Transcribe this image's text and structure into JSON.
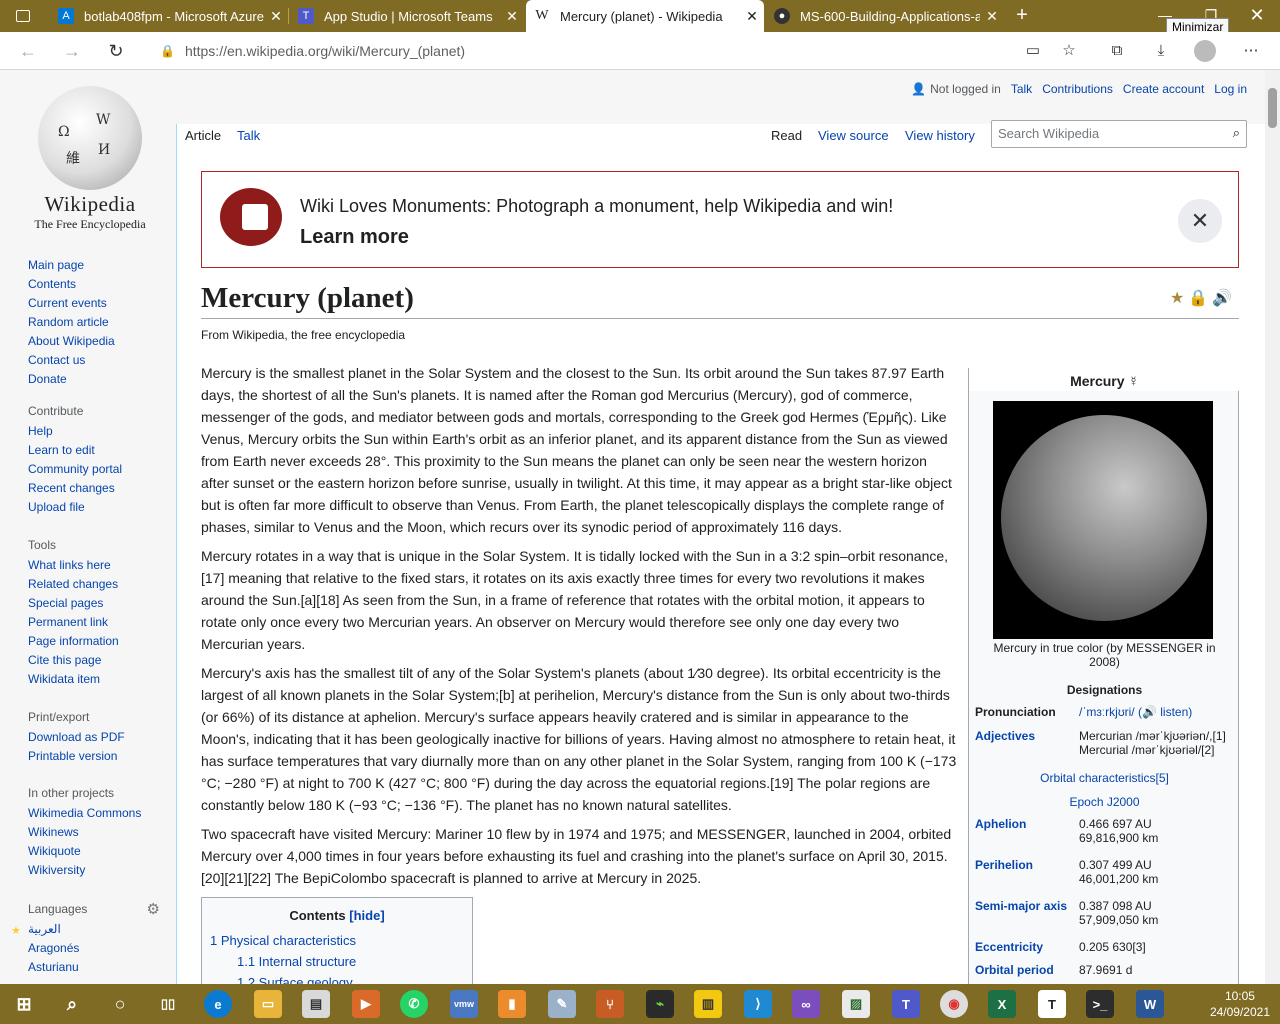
{
  "browser": {
    "tabs": [
      {
        "title": "botlab408fpm - Microsoft Azure",
        "icon": "azure-icon",
        "color": "#0078d4"
      },
      {
        "title": "App Studio | Microsoft Teams",
        "icon": "teams-icon",
        "color": "#5059c9"
      },
      {
        "title": "Mercury (planet) - Wikipedia",
        "icon": "wikipedia-icon",
        "active": true
      },
      {
        "title": "MS-600-Building-Applications-a",
        "icon": "github-icon"
      }
    ],
    "tooltip": "Minimizar",
    "url": "https://en.wikipedia.org/wiki/Mercury_(planet)"
  },
  "wiki": {
    "logo_wordmark": "Wikipedia",
    "logo_tagline": "The Free Encyclopedia",
    "nav": [
      "Main page",
      "Contents",
      "Current events",
      "Random article",
      "About Wikipedia",
      "Contact us",
      "Donate"
    ],
    "contribute": {
      "title": "Contribute",
      "items": [
        "Help",
        "Learn to edit",
        "Community portal",
        "Recent changes",
        "Upload file"
      ]
    },
    "tools": {
      "title": "Tools",
      "items": [
        "What links here",
        "Related changes",
        "Special pages",
        "Permanent link",
        "Page information",
        "Cite this page",
        "Wikidata item"
      ]
    },
    "print": {
      "title": "Print/export",
      "items": [
        "Download as PDF",
        "Printable version"
      ]
    },
    "projects": {
      "title": "In other projects",
      "items": [
        "Wikimedia Commons",
        "Wikinews",
        "Wikiquote",
        "Wikiversity"
      ]
    },
    "languages": {
      "title": "Languages",
      "items": [
        "العربية",
        "Aragonés",
        "Asturianu"
      ]
    },
    "user": {
      "not_logged": "Not logged in",
      "talk": "Talk",
      "contributions": "Contributions",
      "create": "Create account",
      "login": "Log in"
    },
    "tabs": {
      "article": "Article",
      "talk": "Talk",
      "read": "Read",
      "source": "View source",
      "history": "View history"
    },
    "search_placeholder": "Search Wikipedia",
    "banner": {
      "text": "Wiki Loves Monuments: Photograph a monument, help Wikipedia and win!",
      "more": "Learn more"
    },
    "title": "Mercury (planet)",
    "from": "From Wikipedia, the free encyclopedia",
    "paragraphs": [
      "Mercury is the smallest planet in the Solar System and the closest to the Sun. Its orbit around the Sun takes 87.97 Earth days, the shortest of all the Sun's planets. It is named after the Roman god Mercurius (Mercury), god of commerce, messenger of the gods, and mediator between gods and mortals, corresponding to the Greek god Hermes (Ἑρμῆς). Like Venus, Mercury orbits the Sun within Earth's orbit as an inferior planet, and its apparent distance from the Sun as viewed from Earth never exceeds 28°. This proximity to the Sun means the planet can only be seen near the western horizon after sunset or the eastern horizon before sunrise, usually in twilight. At this time, it may appear as a bright star-like object but is often far more difficult to observe than Venus. From Earth, the planet telescopically displays the complete range of phases, similar to Venus and the Moon, which recurs over its synodic period of approximately 116 days.",
      "Mercury rotates in a way that is unique in the Solar System. It is tidally locked with the Sun in a 3:2 spin–orbit resonance,[17] meaning that relative to the fixed stars, it rotates on its axis exactly three times for every two revolutions it makes around the Sun.[a][18] As seen from the Sun, in a frame of reference that rotates with the orbital motion, it appears to rotate only once every two Mercurian years. An observer on Mercury would therefore see only one day every two Mercurian years.",
      "Mercury's axis has the smallest tilt of any of the Solar System's planets (about 1⁄30 degree). Its orbital eccentricity is the largest of all known planets in the Solar System;[b] at perihelion, Mercury's distance from the Sun is only about two-thirds (or 66%) of its distance at aphelion. Mercury's surface appears heavily cratered and is similar in appearance to the Moon's, indicating that it has been geologically inactive for billions of years. Having almost no atmosphere to retain heat, it has surface temperatures that vary diurnally more than on any other planet in the Solar System, ranging from 100 K (−173 °C; −280 °F) at night to 700 K (427 °C; 800 °F) during the day across the equatorial regions.[19] The polar regions are constantly below 180 K (−93 °C; −136 °F). The planet has no known natural satellites.",
      "Two spacecraft have visited Mercury: Mariner 10 flew by in 1974 and 1975; and MESSENGER, launched in 2004, orbited Mercury over 4,000 times in four years before exhausting its fuel and crashing into the planet's surface on April 30, 2015.[20][21][22] The BepiColombo spacecraft is planned to arrive at Mercury in 2025."
    ],
    "infobox": {
      "title": "Mercury ☿",
      "caption": "Mercury in true color (by MESSENGER in 2008)",
      "designations": "Designations",
      "pron_label": "Pronunciation",
      "pron": "/ˈmɜːrkjʊri/ (🔊 listen)",
      "adj_label": "Adjectives",
      "adj1": "Mercurian /mərˈkjʊəriən/,[1]",
      "adj2": "Mercurial /mərˈkjʊəriəl/[2]",
      "orbital": "Orbital characteristics[5]",
      "epoch": "Epoch J2000",
      "aphelion_label": "Aphelion",
      "aphelion1": "0.466 697 AU",
      "aphelion2": "69,816,900 km",
      "perihelion_label": "Perihelion",
      "perihelion1": "0.307 499 AU",
      "perihelion2": "46,001,200 km",
      "sma_label": "Semi-major axis",
      "sma1": "0.387 098 AU",
      "sma2": "57,909,050 km",
      "ecc_label": "Eccentricity",
      "ecc": "0.205 630[3]",
      "period_label": "Orbital period",
      "period": "87.9691 d"
    },
    "toc": {
      "title": "Contents",
      "hide": "[hide]",
      "items": [
        "1  Physical characteristics",
        "1.1  Internal structure",
        "1.2  Surface geology"
      ]
    }
  },
  "taskbar": {
    "time": "10:05",
    "date": "24/09/2021"
  }
}
